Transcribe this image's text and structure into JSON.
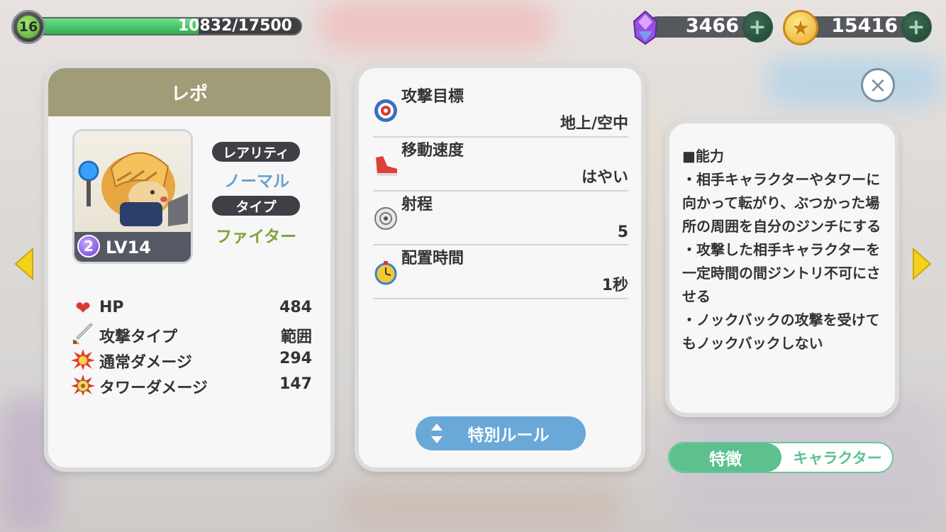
{
  "player": {
    "level": "16",
    "exp": "10832/17500",
    "exp_progress": 0.619
  },
  "currency": {
    "gems": {
      "value": "3466",
      "plus": "+"
    },
    "coins": {
      "value": "15416",
      "plus": "+"
    }
  },
  "character": {
    "name": "レポ",
    "rank": "2",
    "level": "LV14",
    "rarity_label": "レアリティ",
    "rarity": "ノーマル",
    "type_label": "タイプ",
    "type": "ファイター",
    "stats": [
      {
        "icon": "heart-icon",
        "label": "HP",
        "value": "484"
      },
      {
        "icon": "sword-icon",
        "label": "攻撃タイプ",
        "value": "範囲"
      },
      {
        "icon": "explosion-icon",
        "label": "通常ダメージ",
        "value": "294"
      },
      {
        "icon": "tower-damage-icon",
        "label": "タワーダメージ",
        "value": "147"
      }
    ]
  },
  "attributes": [
    {
      "icon": "target-icon",
      "label": "攻撃目標",
      "value": "地上/空中"
    },
    {
      "icon": "shoe-icon",
      "label": "移動速度",
      "value": "はやい"
    },
    {
      "icon": "range-icon",
      "label": "射程",
      "value": "5"
    },
    {
      "icon": "stopwatch-icon",
      "label": "配置時間",
      "value": "1秒"
    }
  ],
  "special_rule_button": "特別ルール",
  "ability": {
    "text": "■能力\n・相手キャラクターやタワーに向かって転がり、ぶつかった場所の周囲を自分のジンチにする\n・攻撃した相手キャラクターを一定時間の間ジントリ不可にさせる\n・ノックバックの攻撃を受けてもノックバックしない"
  },
  "toggle": {
    "active": "特徴",
    "inactive": "キャラクター"
  },
  "close": "×",
  "colors": {
    "header": "#a09c78",
    "rarity": "#6a9fc9",
    "type": "#7ea33b",
    "toggle": "#5cc08f",
    "button": "#6aa8d8"
  }
}
